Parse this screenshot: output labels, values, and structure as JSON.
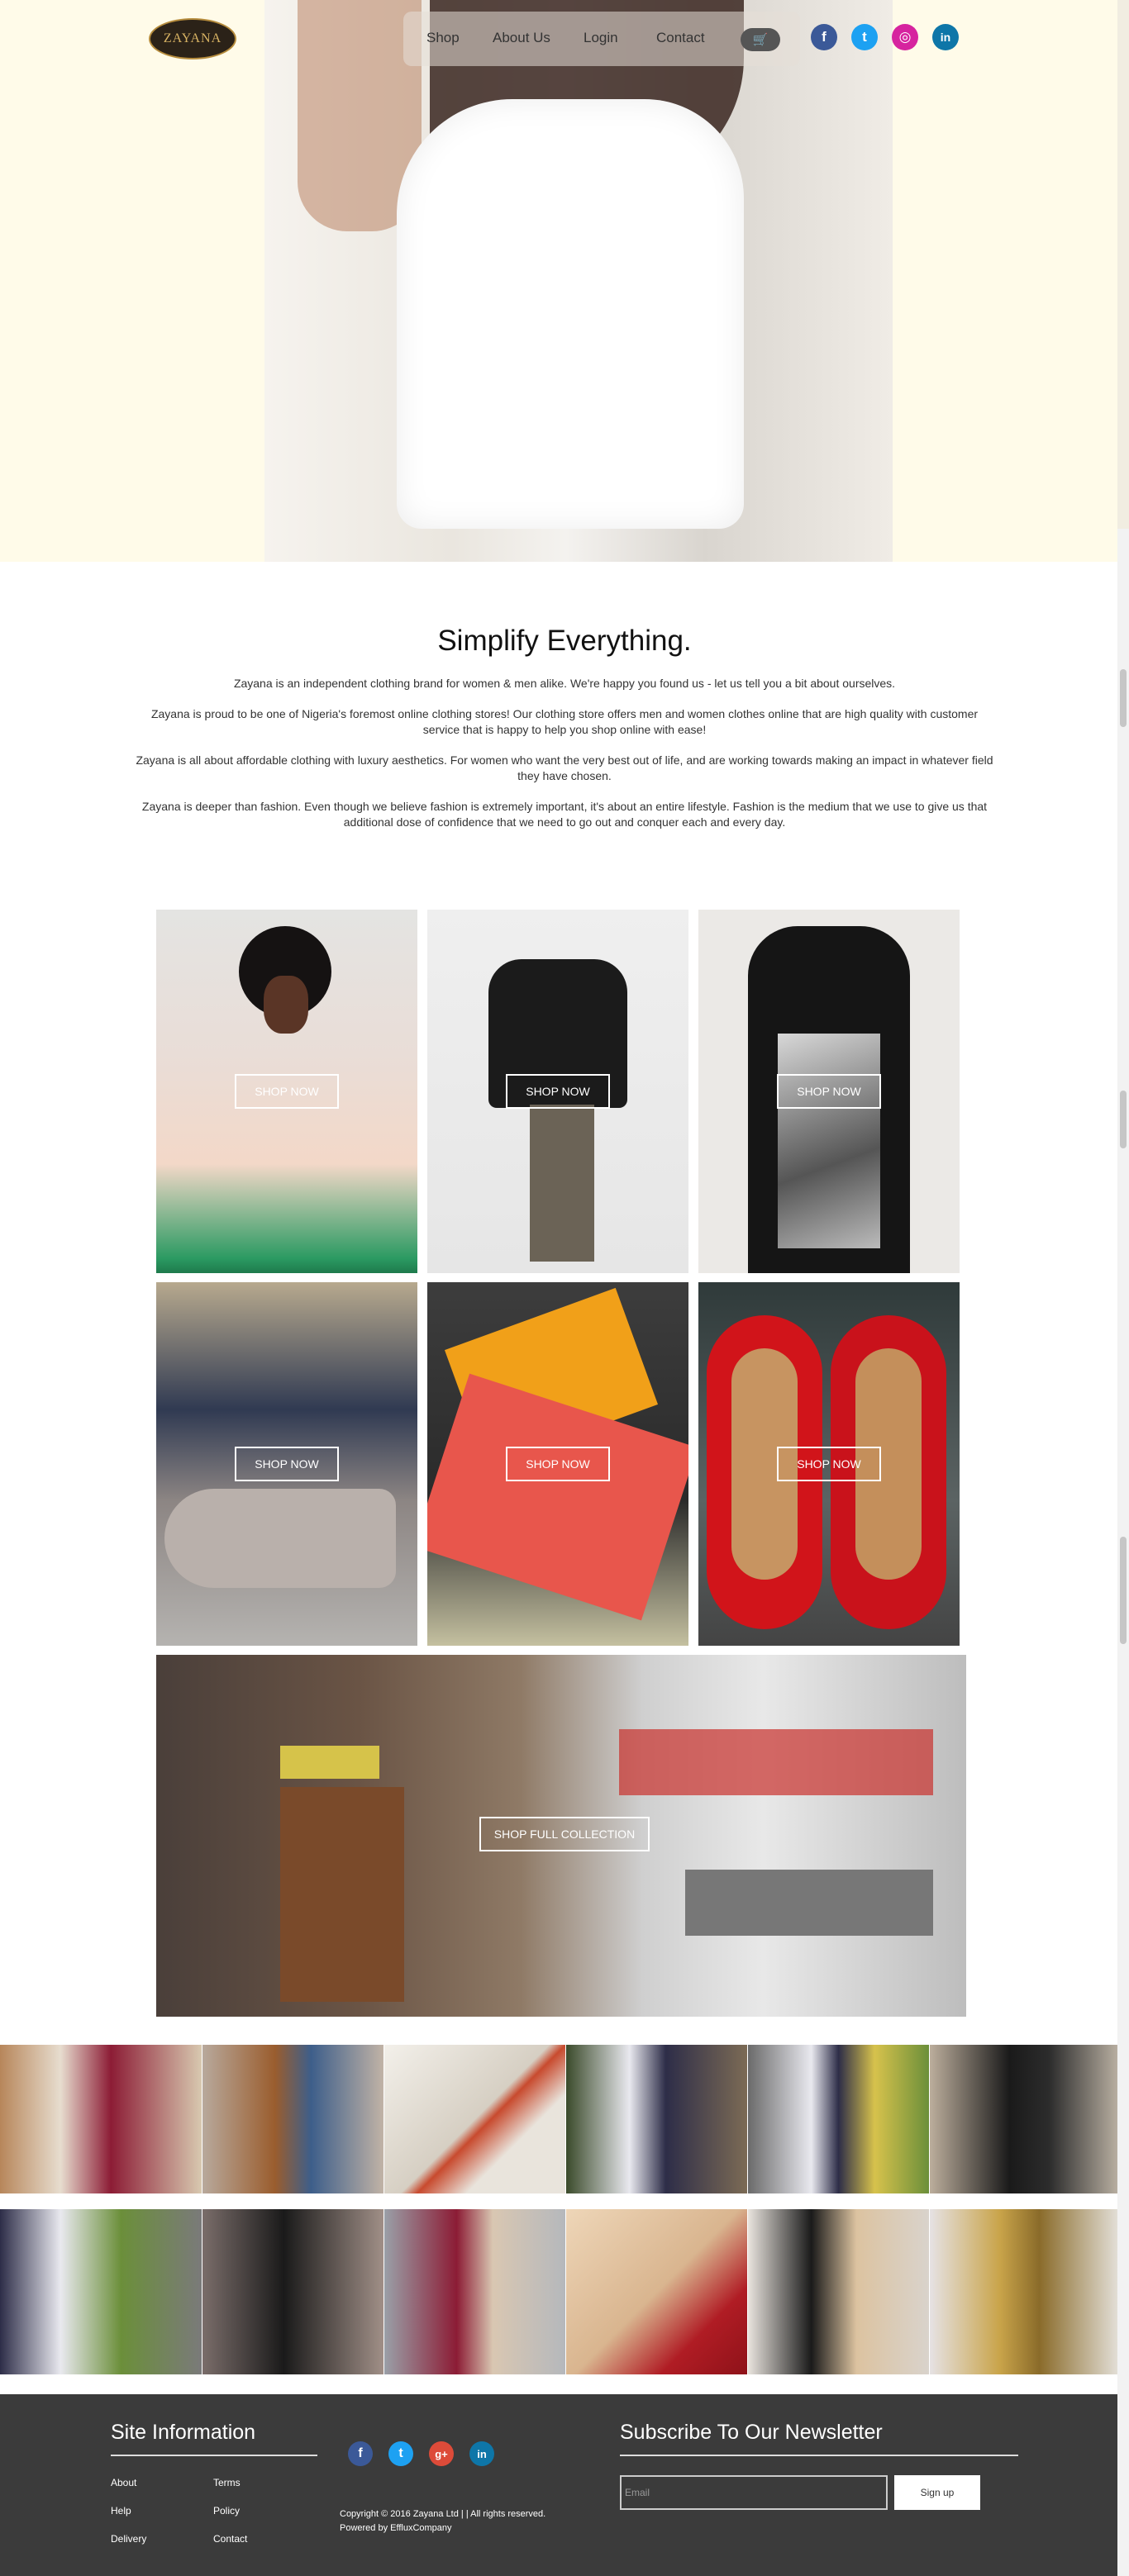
{
  "brand": {
    "logo_text": "ZAYANA"
  },
  "nav": {
    "items": [
      "Shop",
      "About Us",
      "Login",
      "Contact"
    ],
    "cart_icon": "cart-icon"
  },
  "social": [
    {
      "name": "facebook",
      "glyph": "f",
      "color": "#3b5998"
    },
    {
      "name": "twitter",
      "glyph": "t",
      "color": "#1da1f2"
    },
    {
      "name": "instagram",
      "glyph": "◎",
      "color": "#d6249f"
    },
    {
      "name": "linkedin",
      "glyph": "in",
      "color": "#0e76a8"
    }
  ],
  "intro": {
    "title": "Simplify Everything.",
    "paragraphs": [
      "Zayana is an independent clothing brand for women & men alike. We're happy you found us - let us tell you a bit about ourselves.",
      "Zayana is proud to be one of Nigeria's foremost online clothing stores! Our clothing store offers men and women clothes online that are high quality with customer service that is happy to help you shop online with ease!",
      "Zayana is all about affordable clothing with luxury aesthetics. For women who want the very best out of life, and are working towards making an impact in whatever field they have chosen.",
      "Zayana is deeper than fashion. Even though we believe fashion is extremely important, it's about an entire lifestyle. Fashion is the medium that we use to give us that additional dose of confidence that we need to go out and conquer each and every day."
    ]
  },
  "tiles": {
    "shop_label": "SHOP NOW",
    "full_collection_label": "SHOP FULL COLLECTION"
  },
  "footer": {
    "site_info_title": "Site Information",
    "links_col1": [
      "About",
      "Help",
      "Delivery"
    ],
    "links_col2": [
      "Terms",
      "Policy",
      "Contact"
    ],
    "copyright": "Copyright © 2016 Zayana Ltd | | All rights reserved.",
    "powered": "Powered by EffluxCompany",
    "newsletter_title": "Subscribe To Our Newsletter",
    "email_placeholder": "Email",
    "signup_label": "Sign up",
    "social": [
      {
        "name": "facebook",
        "glyph": "f",
        "color": "#3b5998"
      },
      {
        "name": "twitter",
        "glyph": "t",
        "color": "#1da1f2"
      },
      {
        "name": "google-plus",
        "glyph": "g+",
        "color": "#dd4b39"
      },
      {
        "name": "linkedin",
        "glyph": "in",
        "color": "#0e76a8"
      }
    ]
  }
}
